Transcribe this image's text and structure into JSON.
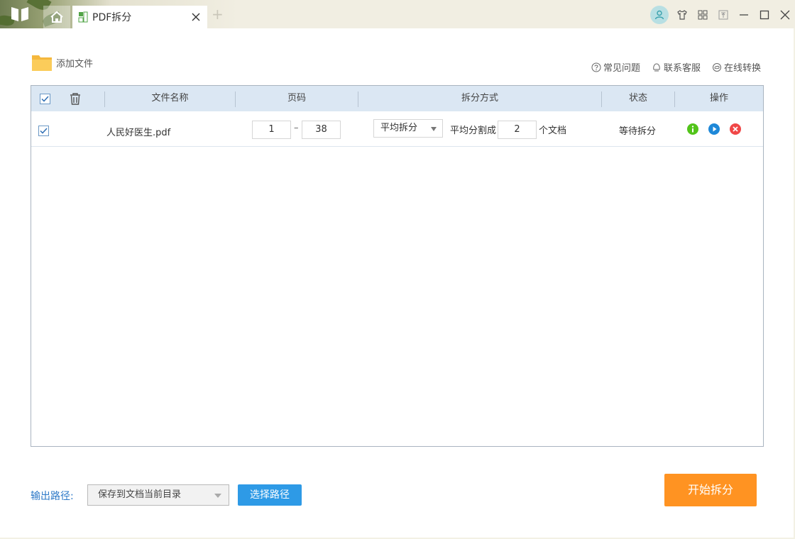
{
  "window": {
    "tab_title": "PDF拆分",
    "new_tab_symbol": "+"
  },
  "toolbar": {
    "add_file_label": "添加文件",
    "links": [
      {
        "label": "常见问题",
        "icon": "question-circle-icon"
      },
      {
        "label": "联系客服",
        "icon": "headset-icon"
      },
      {
        "label": "在线转换",
        "icon": "cloud-convert-icon"
      }
    ]
  },
  "table": {
    "headers": {
      "filename": "文件名称",
      "pages": "页码",
      "split_mode": "拆分方式",
      "status": "状态",
      "actions": "操作"
    },
    "rows": [
      {
        "checked": true,
        "filename": "人民好医生.pdf",
        "page_from": "1",
        "page_to": "38",
        "split_mode": "平均拆分",
        "split_prefix": "平均分割成",
        "split_count": "2",
        "split_suffix": "个文档",
        "status": "等待拆分"
      }
    ]
  },
  "footer": {
    "output_label": "输出路径:",
    "output_value": "保存到文档当前目录",
    "choose_path_label": "选择路径",
    "start_label": "开始拆分"
  },
  "colors": {
    "accent_blue": "#2e9ae6",
    "start_orange": "#ff9322",
    "info_green": "#52c41a",
    "play_blue": "#1e88d8",
    "delete_red": "#f04747",
    "header_bg": "#dbe7f3"
  }
}
